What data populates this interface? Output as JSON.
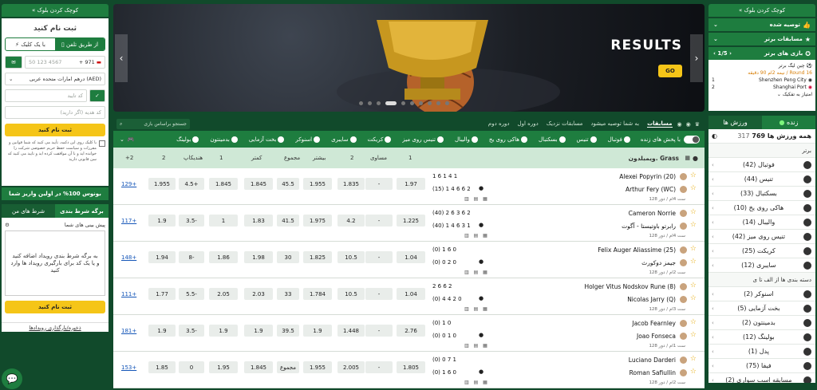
{
  "right_panel": {
    "collapse_label": "« کوچک کردن بلوک",
    "recommended": "توصیه شده",
    "top_competitions": "مسابقات برتر",
    "top_games": "بازی های برتر",
    "pager": "1/5",
    "featured": {
      "league": "چین لیگ برتر",
      "status": "نیمه 2ام 90 دقیقه / Round 16",
      "team1": "Shenzhen Peng City",
      "score1": "1",
      "team2": "Shanghai Port",
      "score2": "2",
      "extra": "امتیاز به تفکیک"
    },
    "tabs": {
      "live": "زنده",
      "sports": "ورزش ها"
    },
    "all_sports": "همه ورزش ها 769",
    "all_count": "317",
    "top_header": "برتر",
    "sports": [
      {
        "name": "فوتبال",
        "count": "(42)"
      },
      {
        "name": "تنیس",
        "count": "(44)"
      },
      {
        "name": "بسکتبال",
        "count": "(33)"
      },
      {
        "name": "هاکی روی یخ",
        "count": "(10)"
      },
      {
        "name": "والیبال",
        "count": "(14)"
      },
      {
        "name": "تنیس روی میز",
        "count": "(42)"
      },
      {
        "name": "کریکت",
        "count": "(25)"
      },
      {
        "name": "سایبری",
        "count": "(12)"
      }
    ],
    "az_header": "دسته بندی ها از الف تا ی",
    "sports2": [
      {
        "name": "اسنوکر",
        "count": "(2)"
      },
      {
        "name": "بخت آزمایی",
        "count": "(5)"
      },
      {
        "name": "بدمینتون",
        "count": "(2)"
      },
      {
        "name": "بولینگ",
        "count": "(12)"
      },
      {
        "name": "پدل",
        "count": "(1)"
      },
      {
        "name": "فیفا",
        "count": "(75)"
      },
      {
        "name": "مسابقه اسب سواری",
        "count": "(2)"
      }
    ]
  },
  "left_panel": {
    "collapse_label": "« کوچک کردن بلوک",
    "register_title": "ثبت نام کنید",
    "tab_phone": "از طریق تلفن",
    "tab_oneclick": "با یک کلیک",
    "phone_code": "+ 971",
    "phone_placeholder": "50 123 4567",
    "currency": "درهم امارات متحده عربی (AED)",
    "confirm_placeholder": "کد تایید",
    "promo_placeholder": "کد هدیه (اگر دارید)",
    "register_button": "ثبت نام کنید",
    "terms": "با کلیک روی این دکمه، تأیید می کنید که شما قوانین و مقررات و سیاست حفظ حریم خصوصی شرکت را خوانده اید و با آن موافقت کرده اید و تایید می کنید که سن قانونی دارید",
    "bonus": "بونوس 100% در اولین واریز شما",
    "tab_betslip": "برگه شرط بندی",
    "tab_mybets": "شرط های من",
    "preview": "پیش بینی های شما",
    "empty_text": "به برگه شرط بندی رویداد اضافه کنید و یا یک کد برای بارگیری رویداد ها وارد کنید",
    "register_button2": "ثبت نام کنید",
    "save_events": "ذخیره/بارگذاری رویدادها"
  },
  "banner": {
    "title": "RESULTS",
    "go": "GO"
  },
  "nav1": {
    "search_placeholder": "جستجو براساس بازی",
    "items": [
      "مسابقات",
      "به شما توصیه میشود",
      "مسابقات نزدیک",
      "دوره اول",
      "دوره دوم"
    ]
  },
  "nav2": {
    "live_toggle": "با پخش های زنده",
    "sports": [
      "فوتبال",
      "تنیس",
      "بسکتبال",
      "هاکی روی یخ",
      "والیبال",
      "تنیس روی میز",
      "کریکت",
      "سایبری",
      "اسنوکر",
      "بخت آزمایی",
      "بدمینتون",
      "بولینگ"
    ]
  },
  "table": {
    "league": "ویمبلدون. Grass",
    "headers": {
      "c1": "1",
      "cx": "مساوی",
      "c2": "2",
      "more": "بیشتر",
      "total": "مجموع",
      "less": "کمتر",
      "h1": "1",
      "hcap": "هندیکاپ",
      "h2": "2",
      "plus": "+2"
    },
    "rows": [
      {
        "p1": "Alexei Popyrin (20)",
        "p2": "Arthur Fery (WC)",
        "s1": "1  6  1  4  1",
        "s2": "(15)  1  4  6  6  2",
        "set1": "(0)",
        "set2": "",
        "meta": "ست 4ام / دور 128",
        "o1": "1.97",
        "ox": "-",
        "o2": "1.835",
        "more": "1.955",
        "tot": "45.5",
        "less": "1.845",
        "h1": "1.845",
        "hc": "4.5+",
        "h2": "1.955",
        "plus": "129+"
      },
      {
        "p1": "Cameron Norrie",
        "p2": "رابرتو باوتیستا - آگوت",
        "s1": "(40)  2  6  3  6  2",
        "s2": "(40)  1  4  6  3  1",
        "meta": "ست 4ام / دور 128",
        "o1": "1.225",
        "ox": "-",
        "o2": "4.2",
        "more": "1.975",
        "tot": "41.5",
        "less": "1.83",
        "h1": "1",
        "hc": "3.5-",
        "h2": "1.9",
        "plus": "117+"
      },
      {
        "p1": "Felix Auger Aliassime (25)",
        "p2": "جیمز دوکورث",
        "s1": "(0)  1  6  0",
        "s2": "(0)  0  2  0",
        "meta": "ست 2ام / دور 128",
        "o1": "1.04",
        "ox": "-",
        "o2": "10.5",
        "more": "1.825",
        "tot": "30",
        "less": "1.98",
        "h1": "1.86",
        "hc": "8-",
        "h2": "1.94",
        "plus": "148+"
      },
      {
        "p1": "Holger Vitus Nodskov Rune (8)",
        "p2": "Nicolas Jarry (Q)",
        "s1": "2  6  6  2",
        "s2": "(0)  4  4  2  0",
        "meta": "ست 3ام / دور 128",
        "o1": "1.04",
        "ox": "-",
        "o2": "10.5",
        "more": "1.784",
        "tot": "33",
        "less": "2.03",
        "h1": "2.05",
        "hc": "5.5-",
        "h2": "1.77",
        "plus": "111+"
      },
      {
        "p1": "Jacob Fearnley",
        "p2": "Joao Fonseca",
        "s1": "(0)  1  0",
        "s2": "(0)  0  1  0",
        "meta": "ست 1ام / دور 128",
        "o1": "2.76",
        "ox": "-",
        "o2": "1.448",
        "more": "1.9",
        "tot": "39.5",
        "less": "1.9",
        "h1": "1.9",
        "hc": "3.5-",
        "h2": "1.9",
        "plus": "181+"
      },
      {
        "p1": "Luciano Darderi",
        "p2": "Roman Safiullin",
        "s1": "(0)  0  7  1",
        "s2": "(0)  1  6  0",
        "meta": "ست 2ام / دور 128",
        "o1": "1.805",
        "ox": "-",
        "o2": "2.005",
        "more": "1.955",
        "tot": "مجموع",
        "less": "1.845",
        "h1": "1.95",
        "hc": "0",
        "h2": "1.85",
        "plus": "153+"
      }
    ]
  },
  "colors": {
    "brand": "#1e7d3f",
    "dark": "#114a2b",
    "accent": "#f5c518"
  }
}
